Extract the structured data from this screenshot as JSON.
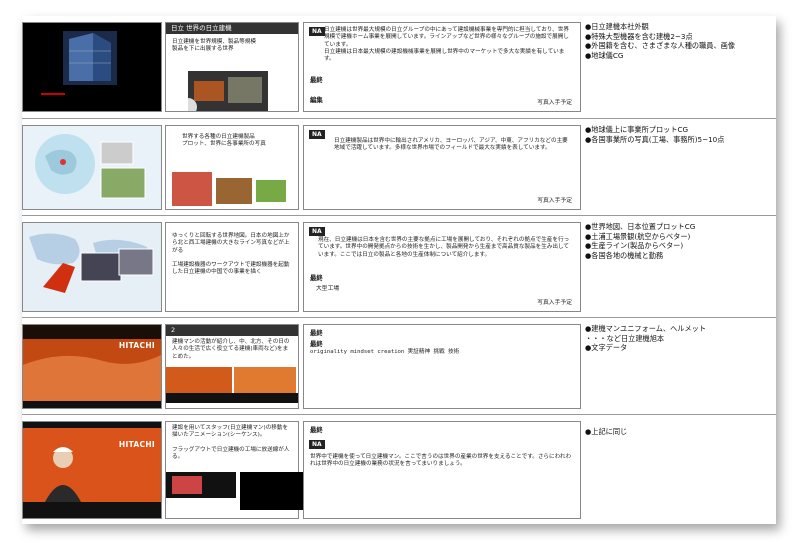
{
  "rows": [
    {
      "thumb_caption": "",
      "mid_header": "日立 世界の日立建機",
      "mid_text": "日立建機を世界規模、製品等規模\n製品を下に出展する世界",
      "na_tag": "NA",
      "na_text": "日立建機は世界最大規模の日立グループの中にあって建設機械事業を専門的に担当しており、世界規模で建機ホーム事業を展開しています。ラインアップなど世界の様々なグループの施設で展開しています。\n日立建機は日本最大規模の建設機械事業を展開し世界中のマーケットで多大な実績を有しています。",
      "label_a": "最終",
      "label_b": "編集",
      "right_note": "写真入手予定",
      "notes": [
        "●日立建機本社外観",
        "●特殊大型機器を含む建機2~3点",
        "●外国籍を含む、さまざまな人種の職員、画像",
        "●地球儀CG"
      ]
    },
    {
      "mid_text": "世界する各種の日立建機製品\nプロット、世界に各事業所の写真",
      "na_tag": "NA",
      "na_text": "日立建機製品は世界中に輸出されアメリカ、ヨーロッパ、アジア、中東、アフリカなどの主要地域で活躍しています。多様な世界市場でのフィールドで最大な実績を表しています。",
      "right_note": "写真入手予定",
      "notes": [
        "●地球儀上に事業所プロットCG",
        "●各国事業所の写真(工場、事務所)5~10点"
      ]
    },
    {
      "mid_text": "ゆっくりと回転する世界地図。日本の地図上から北と西工場建機の大きなライン写真などが上がる\n\n工場建設機器のワークアウトで建設機器を起動した日立建機の中国での事業を描く",
      "na_tag": "NA",
      "na_text": "現在、日立建機は日本を含む世界の主要な拠点に工場を展開しており、それぞれの拠点で生産を行っています。世界中の開発拠点からの技術を生かし、製品開発から生産まで高品質な製品を生み出しています。ここでは日立の製品と各地の生産体制について紹介します。",
      "label_a": "最終",
      "label_b": "大型工場",
      "right_note": "写真入手予定",
      "notes": [
        "●世界地図、日本位置プロットCG",
        "●土浦工場景観(航空からベター)",
        "●生産ライン(製品からベター)",
        "●各国各地の機械と勤務"
      ]
    },
    {
      "thumb_brand": "HITACHI",
      "mid_header": "2",
      "mid_text": "建機マンの活動が紹介し、中、北方、その日の人々の生活で広く役立てる建機(車両など)をまとめた。",
      "na_tag": "NA",
      "label_a": "最終",
      "label_b": "最終",
      "na_text": "originality  mindset  creation  実証精神  挑戦  技術",
      "notes": [
        "●建機マンユニフォーム、ヘルメット",
        "・・・など日立建機旭本",
        "●文字データ"
      ]
    },
    {
      "thumb_brand": "HITACHI",
      "mid_text": "建設を用いてスタッフ(日立建機マン)の移動を描いたアニメーション(シーケンス)。\n\nフラッグアウトで日立建機の工場に放送線が人る。",
      "label_a": "最終",
      "na_tag": "NA",
      "na_text": "世界中で建機を使って日立建機マン。ここで言うのは世界の産業の世界を支えることです。さらにわれわれは世界中の日立建機の業務の状況を言ってまいりましょう。",
      "notes": [
        "●上記に同じ"
      ]
    }
  ]
}
